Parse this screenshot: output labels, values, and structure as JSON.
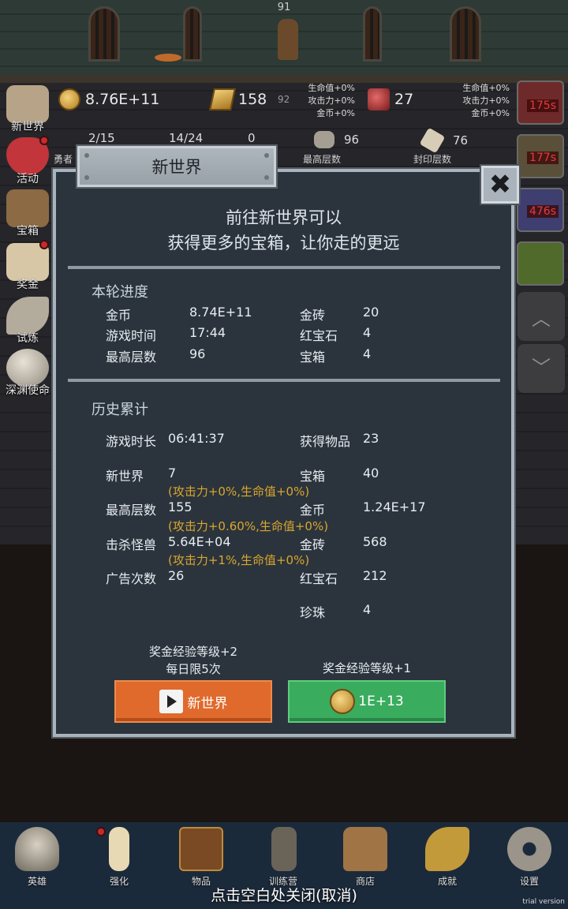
{
  "scene": {
    "hero_level": "91"
  },
  "resources": {
    "gold": "8.76E+11",
    "gold_brick": "158",
    "gold_brick_small": "92",
    "ruby": "27",
    "bonus_left": [
      "生命值+0%",
      "攻击力+0%",
      "金币+0%"
    ],
    "bonus_right": [
      "生命值+0%",
      "攻击力+0%",
      "金币+0%"
    ],
    "hero_tab_label": "勇者",
    "count_a": "2/15",
    "count_b": "14/24",
    "count_c": "0",
    "max_floor_value": "96",
    "max_floor_label": "最高层数",
    "seal_floor_value": "76",
    "seal_floor_label": "封印层数"
  },
  "side_menu": [
    {
      "label": "新世界",
      "icon": "map-icon",
      "dot": false
    },
    {
      "label": "活动",
      "icon": "heart-icon",
      "dot": true
    },
    {
      "label": "宝箱",
      "icon": "chest-icon",
      "dot": false
    },
    {
      "label": "奖金",
      "icon": "letter-icon",
      "dot": true
    },
    {
      "label": "试炼",
      "icon": "feather-icon",
      "dot": false
    },
    {
      "label": "深渊使命",
      "icon": "orb-icon",
      "dot": false
    }
  ],
  "right_timers": [
    "175s",
    "177s",
    "476s"
  ],
  "dialog": {
    "title": "新世界",
    "close_icon": "close-icon",
    "headline_1": "前往新世界可以",
    "headline_2": "获得更多的宝箱，让你走的更远",
    "current": {
      "title": "本轮进度",
      "rows": [
        {
          "label": "金币",
          "value": "8.74E+11",
          "label2": "金砖",
          "value2": "20"
        },
        {
          "label": "游戏时间",
          "value": "17:44",
          "label2": "红宝石",
          "value2": "4"
        },
        {
          "label": "最高层数",
          "value": "96",
          "label2": "宝箱",
          "value2": "4"
        }
      ]
    },
    "history": {
      "title": "历史累计",
      "play_time_label": "游戏时长",
      "play_time": "06:41:37",
      "items_label": "获得物品",
      "items": "23",
      "new_world_label": "新世界",
      "new_world": "7",
      "new_world_bonus": "(攻击力+0%,生命值+0%)",
      "chests_label": "宝箱",
      "chests": "40",
      "max_floor_label": "最高层数",
      "max_floor": "155",
      "max_floor_bonus": "(攻击力+0.60%,生命值+0%)",
      "gold_label": "金币",
      "gold": "1.24E+17",
      "kills_label": "击杀怪兽",
      "kills": "5.64E+04",
      "kills_bonus": "(攻击力+1%,生命值+0%)",
      "bricks_label": "金砖",
      "bricks": "568",
      "ads_label": "广告次数",
      "ads": "26",
      "ruby_label": "红宝石",
      "ruby": "212",
      "pearl_label": "珍珠",
      "pearl": "4"
    },
    "left_caption_1": "奖金经验等级+2",
    "left_caption_2": "每日限5次",
    "right_caption": "奖金经验等级+1",
    "video_button_label": "新世界",
    "coin_button_label": "1E+13"
  },
  "bottom_nav": [
    {
      "label": "英雄",
      "icon": "skull-icon"
    },
    {
      "label": "强化",
      "icon": "candle-icon"
    },
    {
      "label": "物品",
      "icon": "book-icon"
    },
    {
      "label": "训练营",
      "icon": "lantern-icon"
    },
    {
      "label": "商店",
      "icon": "mug-icon"
    },
    {
      "label": "成就",
      "icon": "key-icon"
    },
    {
      "label": "设置",
      "icon": "gear-icon"
    }
  ],
  "close_hint": "点击空白处关闭(取消)",
  "watermark": "trial version",
  "colors": {
    "bonus_text": "#d9a62e",
    "orange_button": "#df6a2c",
    "green_button": "#3aac5e",
    "timer_text": "#e83a3a"
  }
}
